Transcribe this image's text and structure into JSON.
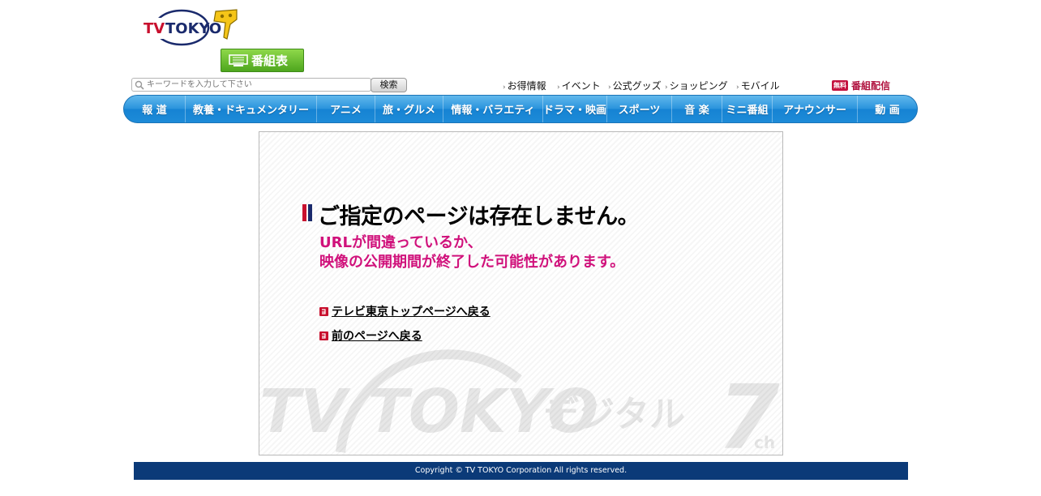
{
  "brand": {
    "logo_text": "TV TOKYO",
    "colors": {
      "nav_blue": "#1d8bd8",
      "footer_navy": "#0b3a78",
      "accent_pink": "#d0117b",
      "logo_red": "#c8102e",
      "logo_navy": "#1a2a6c",
      "logo_yellow": "#f5c518",
      "bangumi_green": "#4ea61e"
    }
  },
  "header": {
    "bangumi_label": "番組表",
    "search": {
      "placeholder": "キーワードを入力して下さい",
      "button_label": "検索"
    },
    "links": [
      "お得情報",
      "イベント",
      "公式グッズ",
      "ショッピング",
      "モバイル"
    ],
    "free_badge": "無料",
    "free_link": "番組配信"
  },
  "nav": {
    "items": [
      "報 道",
      "教養・ドキュメンタリー",
      "アニメ",
      "旅・グルメ",
      "情報・バラエティ",
      "ドラマ・映画",
      "スポーツ",
      "音 楽",
      "ミニ番組",
      "アナウンサー",
      "動 画"
    ]
  },
  "main": {
    "heading": "ご指定のページは存在しません。",
    "message_line1": "URLが間違っているか、",
    "message_line2": "映像の公開期間が終了した可能性があります。",
    "link_top": "テレビ東京トップページへ戻る",
    "link_back": "前のページへ戻る",
    "watermark_text": "TV TOKYO デジタル 7ch"
  },
  "footer": {
    "copyright": "Copyright © TV TOKYO Corporation All rights reserved."
  },
  "icons": [
    "tv-tokyo-logo",
    "tv-icon",
    "search-icon",
    "arrow-link-icon",
    "bullet-icon"
  ]
}
